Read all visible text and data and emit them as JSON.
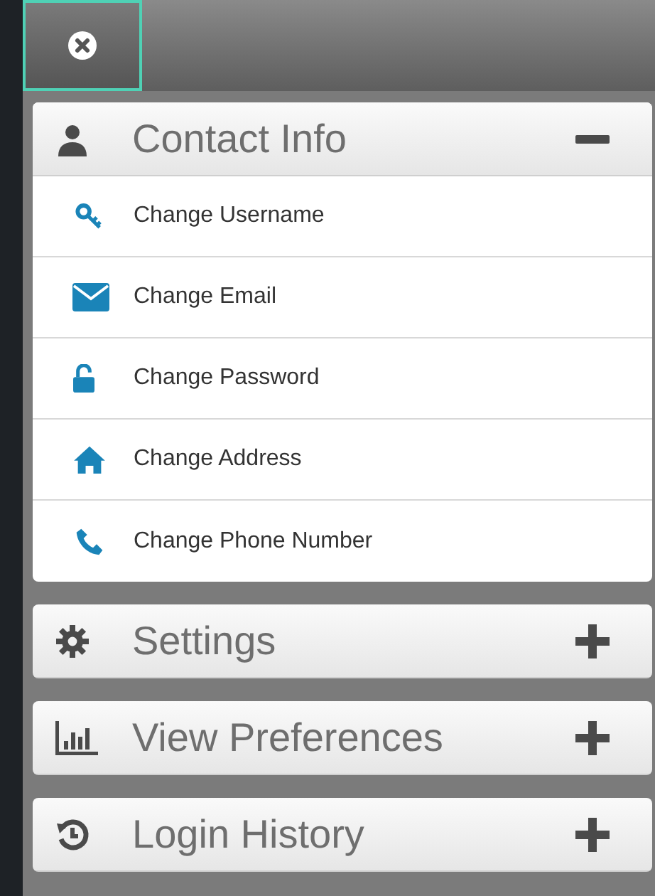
{
  "sections": [
    {
      "title": "Contact Info",
      "expanded": true,
      "items": [
        {
          "label": "Change Username"
        },
        {
          "label": "Change Email"
        },
        {
          "label": "Change Password"
        },
        {
          "label": "Change Address"
        },
        {
          "label": "Change Phone Number"
        }
      ]
    },
    {
      "title": "Settings",
      "expanded": false
    },
    {
      "title": "View Preferences",
      "expanded": false
    },
    {
      "title": "Login History",
      "expanded": false
    }
  ]
}
